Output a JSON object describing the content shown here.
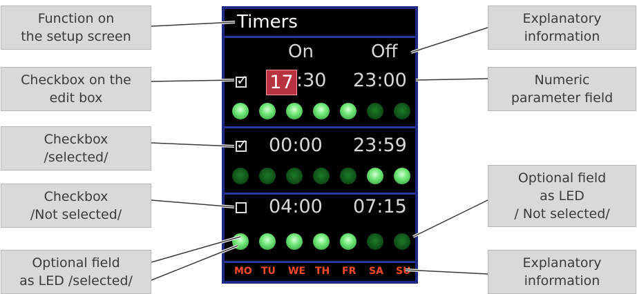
{
  "callouts": {
    "function": [
      "Function on",
      "the setup screen"
    ],
    "checkbox_edit": [
      "Checkbox on the",
      "edit box"
    ],
    "checkbox_selected": [
      "Checkbox",
      "/selected/"
    ],
    "checkbox_not_selected": [
      "Checkbox",
      "/Not selected/"
    ],
    "led_selected": [
      "Optional field",
      "as LED /selected/"
    ],
    "explanatory_top": [
      "Explanatory",
      "information"
    ],
    "numeric": [
      "Numeric",
      "parameter field"
    ],
    "led_not_selected": [
      "Optional field",
      "as LED",
      "/ Not selected/"
    ],
    "explanatory_bottom": [
      "Explanatory",
      "information"
    ]
  },
  "screen": {
    "title": "Timers",
    "col_on": "On",
    "col_off": "Off",
    "rows": [
      {
        "checkbox": "checked",
        "on_hour": "17",
        "on_min": ":30",
        "off": "23:00",
        "leds": [
          true,
          true,
          true,
          true,
          true,
          false,
          false
        ]
      },
      {
        "checkbox": "checked",
        "on": "00:00",
        "off": "23:59",
        "leds": [
          false,
          false,
          false,
          false,
          false,
          true,
          true
        ]
      },
      {
        "checkbox": "unchecked",
        "on": "04:00",
        "off": "07:15",
        "leds": [
          true,
          true,
          true,
          true,
          true,
          false,
          false
        ]
      }
    ],
    "days": [
      "MO",
      "TU",
      "WE",
      "TH",
      "FR",
      "SA",
      "SU"
    ]
  },
  "colors": {
    "device_frame": "#1f2a85",
    "led_on": "#73e87a",
    "led_off": "#0d4a16",
    "day_text": "#ff4a2a",
    "highlight": "#b8323f"
  }
}
